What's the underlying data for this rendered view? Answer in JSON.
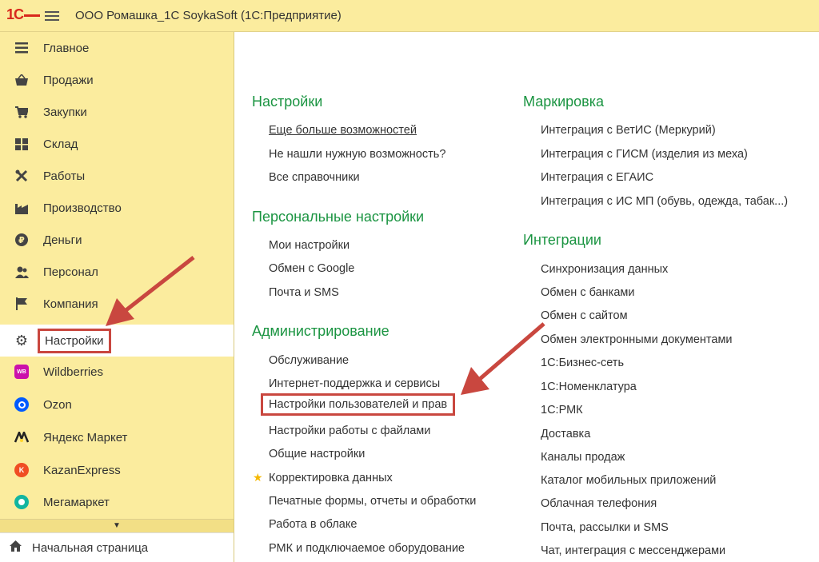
{
  "header": {
    "logo": "1С",
    "title": "ООО Ромашка_1С SoykaSoft  (1С:Предприятие)"
  },
  "sidebar": {
    "items": [
      {
        "label": "Главное",
        "icon": "main-menu-icon"
      },
      {
        "label": "Продажи",
        "icon": "basket-icon"
      },
      {
        "label": "Закупки",
        "icon": "cart-icon"
      },
      {
        "label": "Склад",
        "icon": "warehouse-icon"
      },
      {
        "label": "Работы",
        "icon": "tools-icon"
      },
      {
        "label": "Производство",
        "icon": "factory-icon"
      },
      {
        "label": "Деньги",
        "icon": "money-icon"
      },
      {
        "label": "Персонал",
        "icon": "people-icon"
      },
      {
        "label": "Компания",
        "icon": "flag-icon"
      },
      {
        "label": "Настройки",
        "icon": "gear-icon",
        "active": true
      },
      {
        "label": "Wildberries",
        "icon": "wildberries-icon",
        "badge": "WB",
        "badge_color": "#cb11ab"
      },
      {
        "label": "Ozon",
        "icon": "ozon-icon",
        "badge_color": "#005bff"
      },
      {
        "label": "Яндекс Маркет",
        "icon": "yandex-market-icon",
        "badge_color": "#fed42b"
      },
      {
        "label": "KazanExpress",
        "icon": "kazanexpress-icon",
        "badge_color": "#f04e23"
      },
      {
        "label": "Мегамаркет",
        "icon": "megamarket-icon",
        "badge_color": "#12b5a0"
      }
    ],
    "home_label": "Начальная страница"
  },
  "content": {
    "left": [
      {
        "title": "Настройки",
        "links": [
          "Еще больше возможностей",
          "Не нашли нужную возможность?",
          "Все справочники"
        ]
      },
      {
        "title": "Персональные настройки",
        "links": [
          "Мои настройки",
          "Обмен с Google",
          "Почта и SMS"
        ]
      },
      {
        "title": "Администрирование",
        "links": [
          "Обслуживание",
          "Интернет-поддержка и сервисы",
          "Настройки пользователей и прав",
          "Настройки работы с файлами",
          "Общие настройки",
          "Корректировка данных",
          "Печатные формы, отчеты и обработки",
          "Работа в облаке",
          "РМК и подключаемое оборудование"
        ]
      }
    ],
    "right": [
      {
        "title": "Маркировка",
        "links": [
          "Интеграция с ВетИС (Меркурий)",
          "Интеграция с ГИСМ (изделия из меха)",
          "Интеграция с ЕГАИС",
          "Интеграция с ИС МП (обувь, одежда, табак...)"
        ]
      },
      {
        "title": "Интеграции",
        "links": [
          "Синхронизация данных",
          "Обмен с банками",
          "Обмен с сайтом",
          "Обмен электронными документами",
          "1С:Бизнес-сеть",
          "1С:Номенклатура",
          "1С:РМК",
          "Доставка",
          "Каналы продаж",
          "Каталог мобильных приложений",
          "Облачная телефония",
          "Почта, рассылки и SMS",
          "Чат, интеграция с мессенджерами"
        ]
      }
    ]
  },
  "colors": {
    "accent_green": "#1a9441",
    "sidebar_bg": "#fbec9e",
    "highlight_red": "#c9473f",
    "star": "#f5b800"
  }
}
